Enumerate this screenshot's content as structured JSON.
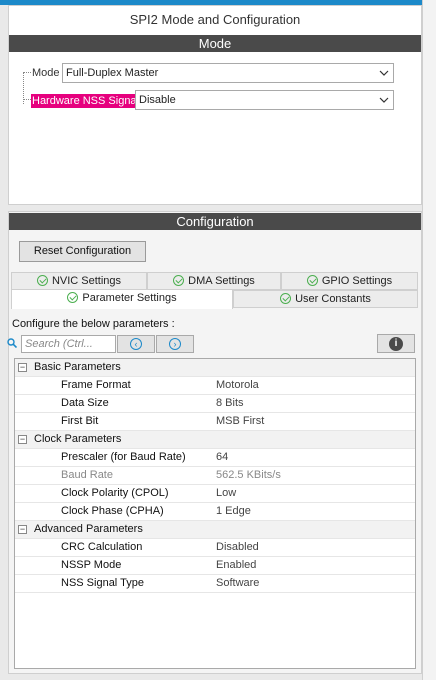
{
  "window": {
    "title": "SPI2 Mode and Configuration"
  },
  "mode_section": {
    "header": "Mode",
    "mode_label": "Mode",
    "mode_value": "Full-Duplex Master",
    "nss_label": "Hardware NSS Signal",
    "nss_value": "Disable"
  },
  "config_section": {
    "header": "Configuration",
    "reset_button": "Reset Configuration",
    "tabs_row1": [
      "NVIC Settings",
      "DMA Settings",
      "GPIO Settings"
    ],
    "tabs_row2": [
      "Parameter Settings",
      "User Constants"
    ],
    "instructions": "Configure the below parameters :",
    "search_placeholder": "Search (Ctrl...",
    "groups": [
      {
        "name": "Basic Parameters",
        "params": [
          {
            "name": "Frame Format",
            "value": "Motorola"
          },
          {
            "name": "Data Size",
            "value": "8 Bits"
          },
          {
            "name": "First Bit",
            "value": "MSB First"
          }
        ]
      },
      {
        "name": "Clock Parameters",
        "params": [
          {
            "name": "Prescaler (for Baud Rate)",
            "value": "64"
          },
          {
            "name": "Baud Rate",
            "value": "562.5 KBits/s"
          },
          {
            "name": "Clock Polarity (CPOL)",
            "value": "Low"
          },
          {
            "name": "Clock Phase (CPHA)",
            "value": "1 Edge"
          }
        ]
      },
      {
        "name": "Advanced Parameters",
        "params": [
          {
            "name": "CRC Calculation",
            "value": "Disabled"
          },
          {
            "name": "NSSP Mode",
            "value": "Enabled"
          },
          {
            "name": "NSS Signal Type",
            "value": "Software"
          }
        ]
      }
    ]
  },
  "colors": {
    "accent_blue": "#1c89c9",
    "section_header": "#4a4a4a",
    "highlight_pink": "#e6007e",
    "check_green": "#4caf50"
  }
}
